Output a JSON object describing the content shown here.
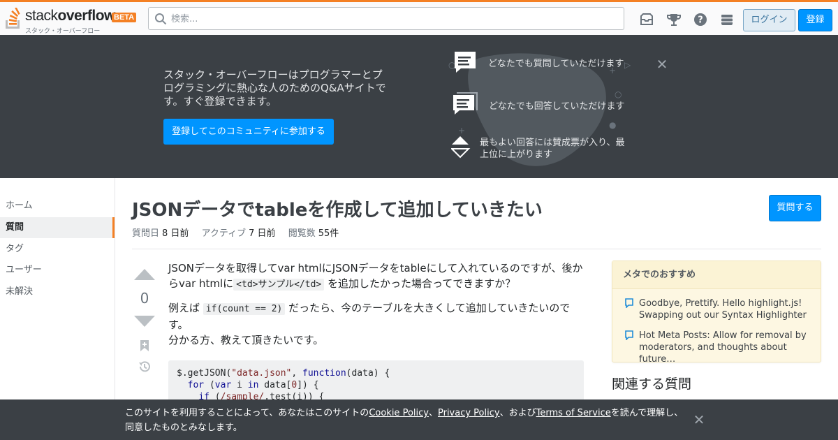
{
  "header": {
    "logo_prefix": "stack",
    "logo_bold": "overflow",
    "logo_badge": "BETA",
    "logo_sub": "スタック・オーバーフロー",
    "search_placeholder": "検索...",
    "login_label": "ログイン",
    "signup_label": "登録",
    "icons": [
      "inbox-icon",
      "achievements-icon",
      "help-icon",
      "site-switcher-icon"
    ],
    "accent_color": "#f48024"
  },
  "hero": {
    "text": "スタック・オーバーフローはプログラマーとプログラミングに熱心な人のためのQ&Aサイトです。すぐ登録できます。",
    "button_label": "登録してこのコミュニティに参加する",
    "close_symbol": "✕",
    "features": [
      {
        "icon": "question-bubble-icon",
        "text": "どなたでも質問していただけます"
      },
      {
        "icon": "answer-bubble-icon",
        "text": "どなたでも回答していただけます"
      },
      {
        "icon": "vote-arrows-icon",
        "text": "最もよい回答には賛成票が入り、最上位に上がります"
      }
    ]
  },
  "nav": {
    "items": [
      {
        "label": "ホーム",
        "active": false
      },
      {
        "label": "質問",
        "active": true
      },
      {
        "label": "タグ",
        "active": false
      },
      {
        "label": "ユーザー",
        "active": false
      },
      {
        "label": "未解決",
        "active": false
      }
    ]
  },
  "question": {
    "title": "JSONデータでtableを作成して追加していきたい",
    "ask_label": "質問する",
    "asked_label": "質問日",
    "asked_value": "8 日前",
    "active_label": "アクティブ",
    "active_value": "7 日前",
    "views_label": "閲覧数",
    "views_value": "55件",
    "votes": "0",
    "body": {
      "p1_a": "JSONデータを取得してvar htmlにJSONデータをtableにして入れているのですが、後からvar htmlに",
      "p1_code": "<td>サンプル</td>",
      "p1_b": "を追加したかった場合ってできますか？",
      "p2_a": "例えば",
      "p2_code": "if(count == 2)",
      "p2_b": "だったら、今のテーブルを大きくして追加していきたいのです。",
      "p3": "分かる方、教えて頂きたいです。"
    },
    "code": {
      "l1_a": "$.getJSON(",
      "l1_str": "\"data.json\"",
      "l1_b": ", ",
      "l1_kw": "function",
      "l1_c": "(data) {",
      "l2_kw1": "for",
      "l2_a": " (",
      "l2_kw2": "var",
      "l2_b": " i ",
      "l2_kw3": "in",
      "l2_c": " data[",
      "l2_num": "0",
      "l2_d": "]) {",
      "l3_kw": "if",
      "l3_a": " (",
      "l3_rx": "/sample/",
      "l3_b": ".test(i)) {"
    }
  },
  "sidebar": {
    "meta_title": "メタでのおすすめ",
    "meta_links": [
      "Goodbye, Prettify. Hello highlight.js! Swapping out our Syntax Highlighter",
      "Hot Meta Posts: Allow for removal by moderators, and thoughts about future…"
    ],
    "related_title": "関連する質問"
  },
  "cookie": {
    "t1": "このサイトを利用することによって、あなたはこのサイトの",
    "link1": "Cookie Policy",
    "sep1": "、",
    "link2": "Privacy Policy",
    "t2": "、および",
    "link3": "Terms of Service",
    "t3": "を読んで理解し、同意したものとみなします。",
    "close_symbol": "✕"
  }
}
